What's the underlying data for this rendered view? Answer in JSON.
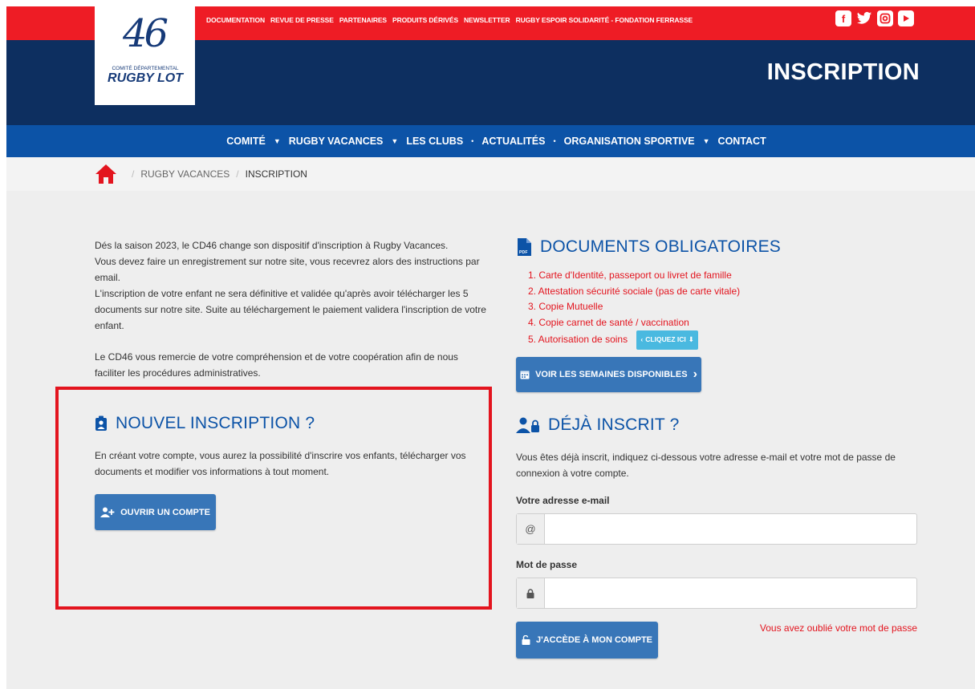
{
  "topbar": {
    "links": [
      "DOCUMENTATION",
      "REVUE DE PRESSE",
      "PARTENAIRES",
      "PRODUITS DÉRIVÉS",
      "NEWSLETTER",
      "RUGBY ESPOIR SOLIDARITÉ - FONDATION FERRASSE"
    ],
    "socials": [
      "facebook-icon",
      "twitter-icon",
      "instagram-icon",
      "youtube-icon"
    ]
  },
  "logo": {
    "number": "46",
    "small": "COMITÉ DÉPARTEMENTAL",
    "big": "RUGBY LOT"
  },
  "header": {
    "title": "INSCRIPTION"
  },
  "nav": {
    "items": [
      "COMITÉ",
      "RUGBY VACANCES",
      "LES CLUBS",
      "ACTUALITÉS",
      "ORGANISATION SPORTIVE",
      "CONTACT"
    ]
  },
  "breadcrumb": {
    "items": [
      "RUGBY VACANCES",
      "INSCRIPTION"
    ]
  },
  "intro": {
    "p1": "Dés la saison 2023, le CD46 change son dispositif d'inscription à Rugby Vacances.\nVous devez faire un enregistrement sur notre site, vous recevrez alors des instructions par email.\nL'inscription de votre enfant ne sera définitive et validée qu'après avoir télécharger les 5 documents sur notre site. Suite au téléchargement le paiement validera l'inscription de votre enfant.",
    "p2": "Le CD46 vous remercie de votre compréhension et de votre coopération afin de nous faciliter les procédures administratives."
  },
  "nouvel": {
    "title": "NOUVEL INSCRIPTION ?",
    "text": "En créant votre compte, vous aurez la possibilité d'inscrire vos enfants, télécharger vos documents et modifier vos informations à tout moment.",
    "button": "OUVRIR UN COMPTE"
  },
  "documents": {
    "title": "DOCUMENTS OBLIGATOIRES",
    "items": [
      "1. Carte d'Identité, passeport ou livret de famille",
      "2. Attestation sécurité sociale (pas de carte vitale)",
      "3. Copie Mutuelle",
      "4. Copie carnet de santé / vaccination",
      "5. Autorisation de soins"
    ],
    "cliquez": "CLIQUEZ ICI",
    "weeks_button": "VOIR LES SEMAINES DISPONIBLES"
  },
  "deja": {
    "title": "DÉJÀ INSCRIT ?",
    "text": "Vous êtes déjà inscrit, indiquez ci-dessous votre adresse e-mail et votre mot de passe de connexion à votre compte.",
    "email_label": "Votre adresse e-mail",
    "email_value": "",
    "password_label": "Mot de passe",
    "password_value": "",
    "login_button": "J'ACCÈDE À MON COMPTE",
    "forgot": "Vous avez oublié votre mot de passe"
  },
  "colors": {
    "red": "#ee1c25",
    "navy": "#0d2f60",
    "blue": "#0c53a7",
    "button": "#3876b8"
  }
}
